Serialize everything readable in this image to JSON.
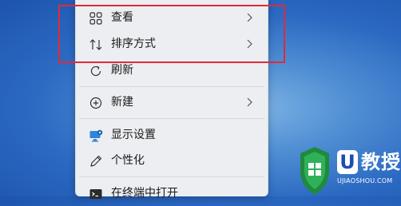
{
  "menu": {
    "items": [
      {
        "label": "查看",
        "icon": "grid-icon",
        "has_submenu": true
      },
      {
        "label": "排序方式",
        "icon": "sort-arrows-icon",
        "has_submenu": true
      },
      {
        "label": "刷新",
        "icon": "refresh-icon",
        "has_submenu": false
      },
      {
        "label": "新建",
        "icon": "plus-circle-icon",
        "has_submenu": true
      },
      {
        "label": "显示设置",
        "icon": "display-settings-icon",
        "has_submenu": false
      },
      {
        "label": "个性化",
        "icon": "pen-icon",
        "has_submenu": false
      },
      {
        "label": "在终端中打开",
        "icon": "terminal-icon",
        "has_submenu": false
      }
    ]
  },
  "annotation": {
    "color": "#de2b3a"
  },
  "watermark": {
    "badge": "U",
    "brand": "教授",
    "url": "UJIAOSHOU.COM"
  },
  "colors": {
    "desktop": "#2b69c2",
    "menu_background": "#eceef1",
    "accent": "#1a4faf"
  }
}
